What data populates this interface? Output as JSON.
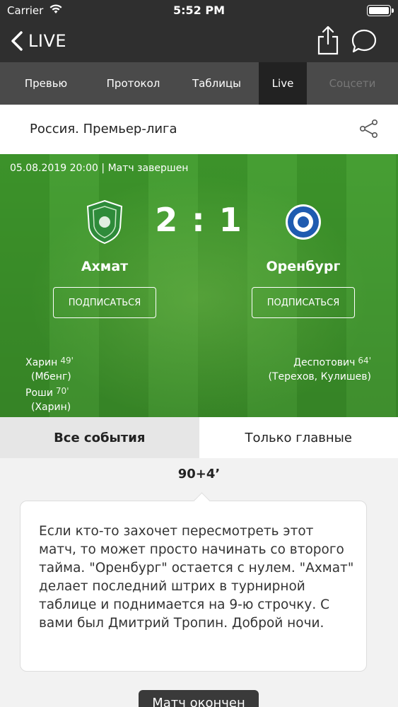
{
  "status": {
    "carrier": "Carrier",
    "time": "5:52 PM"
  },
  "nav": {
    "back_label": "LIVE"
  },
  "tabs": [
    {
      "label": "Превью"
    },
    {
      "label": "Протокол"
    },
    {
      "label": "Таблицы"
    },
    {
      "label": "Live"
    },
    {
      "label": "Соцсети"
    }
  ],
  "league": {
    "name": "Россия. Премьер-лига"
  },
  "match": {
    "meta": "05.08.2019 20:00 | Матч завершен",
    "score": "2 : 1",
    "home": {
      "name": "Ахмат",
      "subscribe": "ПОДПИСАТЬСЯ",
      "crest_color": "#2e8b3a"
    },
    "away": {
      "name": "Оренбург",
      "subscribe": "ПОДПИСАТЬСЯ",
      "crest_color": "#1f5bb0"
    },
    "home_goals": [
      {
        "player": "Харин",
        "minute": "49'",
        "assist": "(Мбенг)"
      },
      {
        "player": "Роши",
        "minute": "70'",
        "assist": "(Харин)"
      }
    ],
    "away_goals": [
      {
        "player": "Деспотович",
        "minute": "64'",
        "assist": "(Терехов, Кулишев)"
      }
    ]
  },
  "filter": {
    "all": "Все события",
    "main": "Только главные"
  },
  "event": {
    "minute": "90+4’",
    "text": "Если кто-то захочет пересмотреть этот матч, то может просто начинать со второго тайма. \"Оренбург\" остается с нулем. \"Ахмат\" делает последний штрих в турнирной таблице и поднимается на 9-ю строчку. С вами был Дмитрий Тропин. Доброй ночи."
  },
  "badge": {
    "ended": "Матч окончен"
  }
}
